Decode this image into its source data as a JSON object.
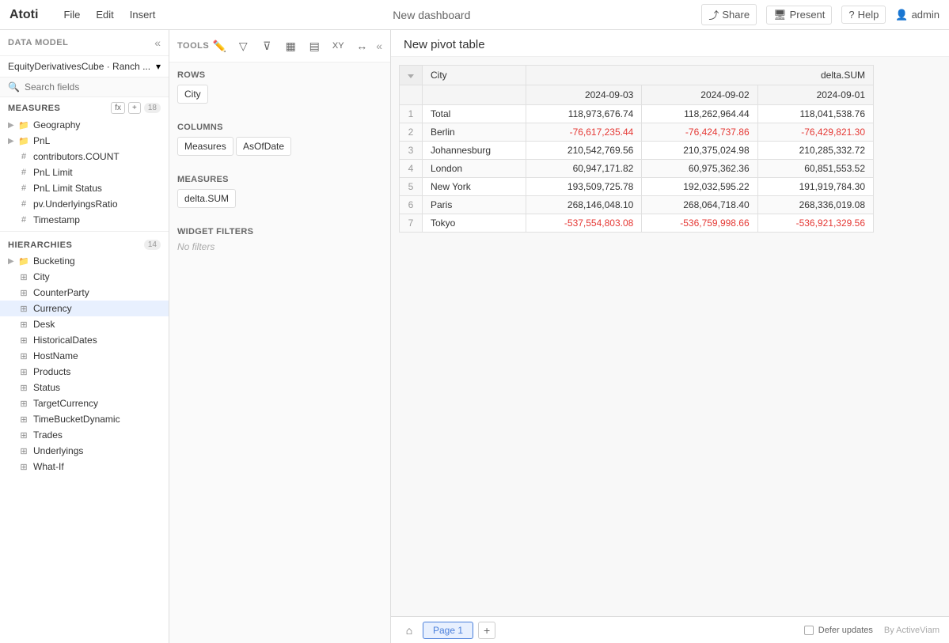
{
  "app": {
    "logo": "Atoti",
    "menu": [
      "File",
      "Edit",
      "Insert"
    ],
    "title": "New dashboard",
    "actions": {
      "share": "Share",
      "present": "Present",
      "help": "Help",
      "user": "admin"
    }
  },
  "left_panel": {
    "header": "DATA MODEL",
    "cube": "EquityDerivativesCube · Ranch ...",
    "search_placeholder": "Search fields",
    "measures_label": "MEASURES",
    "measures_count": "18",
    "measures_items": [
      {
        "type": "folder",
        "label": "Geography"
      },
      {
        "type": "folder",
        "label": "PnL"
      },
      {
        "type": "hash",
        "label": "contributors.COUNT"
      },
      {
        "type": "hash",
        "label": "PnL Limit"
      },
      {
        "type": "hash",
        "label": "PnL Limit Status"
      },
      {
        "type": "hash",
        "label": "pv.UnderlyingsRatio"
      },
      {
        "type": "hash",
        "label": "Timestamp"
      }
    ],
    "hierarchies_label": "HIERARCHIES",
    "hierarchies_count": "14",
    "hierarchies_items": [
      {
        "type": "folder",
        "label": "Bucketing"
      },
      {
        "type": "hier",
        "label": "City"
      },
      {
        "type": "hier",
        "label": "CounterParty"
      },
      {
        "type": "hier",
        "label": "Currency",
        "active": true
      },
      {
        "type": "hier",
        "label": "Desk"
      },
      {
        "type": "hier",
        "label": "HistoricalDates"
      },
      {
        "type": "hier",
        "label": "HostName"
      },
      {
        "type": "hier",
        "label": "Products"
      },
      {
        "type": "hier",
        "label": "Status"
      },
      {
        "type": "hier",
        "label": "TargetCurrency"
      },
      {
        "type": "hier",
        "label": "TimeBucketDynamic"
      },
      {
        "type": "hier",
        "label": "Trades"
      },
      {
        "type": "hier",
        "label": "Underlyings"
      },
      {
        "type": "hier",
        "label": "What-If"
      }
    ]
  },
  "tools_panel": {
    "header": "TOOLS",
    "rows_label": "Rows",
    "rows_fields": [
      "City"
    ],
    "columns_label": "Columns",
    "columns_fields": [
      "Measures",
      "AsOfDate"
    ],
    "measures_label": "Measures",
    "measures_fields": [
      "delta.SUM"
    ],
    "widget_filters_label": "Widget filters",
    "no_filters": "No filters"
  },
  "table": {
    "title": "New pivot table",
    "col_city": "City",
    "col_delta": "delta.SUM",
    "col_date1": "2024-09-03",
    "col_date2": "2024-09-02",
    "col_date3": "2024-09-01",
    "rows": [
      {
        "num": "1",
        "city": "Total",
        "v1": "118,973,676.74",
        "v2": "118,262,964.44",
        "v3": "118,041,538.76",
        "neg1": false,
        "neg2": false,
        "neg3": false
      },
      {
        "num": "2",
        "city": "Berlin",
        "v1": "-76,617,235.44",
        "v2": "-76,424,737.86",
        "v3": "-76,429,821.30",
        "neg1": true,
        "neg2": true,
        "neg3": true
      },
      {
        "num": "3",
        "city": "Johannesburg",
        "v1": "210,542,769.56",
        "v2": "210,375,024.98",
        "v3": "210,285,332.72",
        "neg1": false,
        "neg2": false,
        "neg3": false
      },
      {
        "num": "4",
        "city": "London",
        "v1": "60,947,171.82",
        "v2": "60,975,362.36",
        "v3": "60,851,553.52",
        "neg1": false,
        "neg2": false,
        "neg3": false
      },
      {
        "num": "5",
        "city": "New York",
        "v1": "193,509,725.78",
        "v2": "192,032,595.22",
        "v3": "191,919,784.30",
        "neg1": false,
        "neg2": false,
        "neg3": false
      },
      {
        "num": "6",
        "city": "Paris",
        "v1": "268,146,048.10",
        "v2": "268,064,718.40",
        "v3": "268,336,019.08",
        "neg1": false,
        "neg2": false,
        "neg3": false
      },
      {
        "num": "7",
        "city": "Tokyo",
        "v1": "-537,554,803.08",
        "v2": "-536,759,998.66",
        "v3": "-536,921,329.56",
        "neg1": true,
        "neg2": true,
        "neg3": true
      }
    ]
  },
  "bottom_bar": {
    "page_label": "Page 1",
    "defer_updates": "Defer updates",
    "by_active_viam": "By ActiveViam"
  }
}
